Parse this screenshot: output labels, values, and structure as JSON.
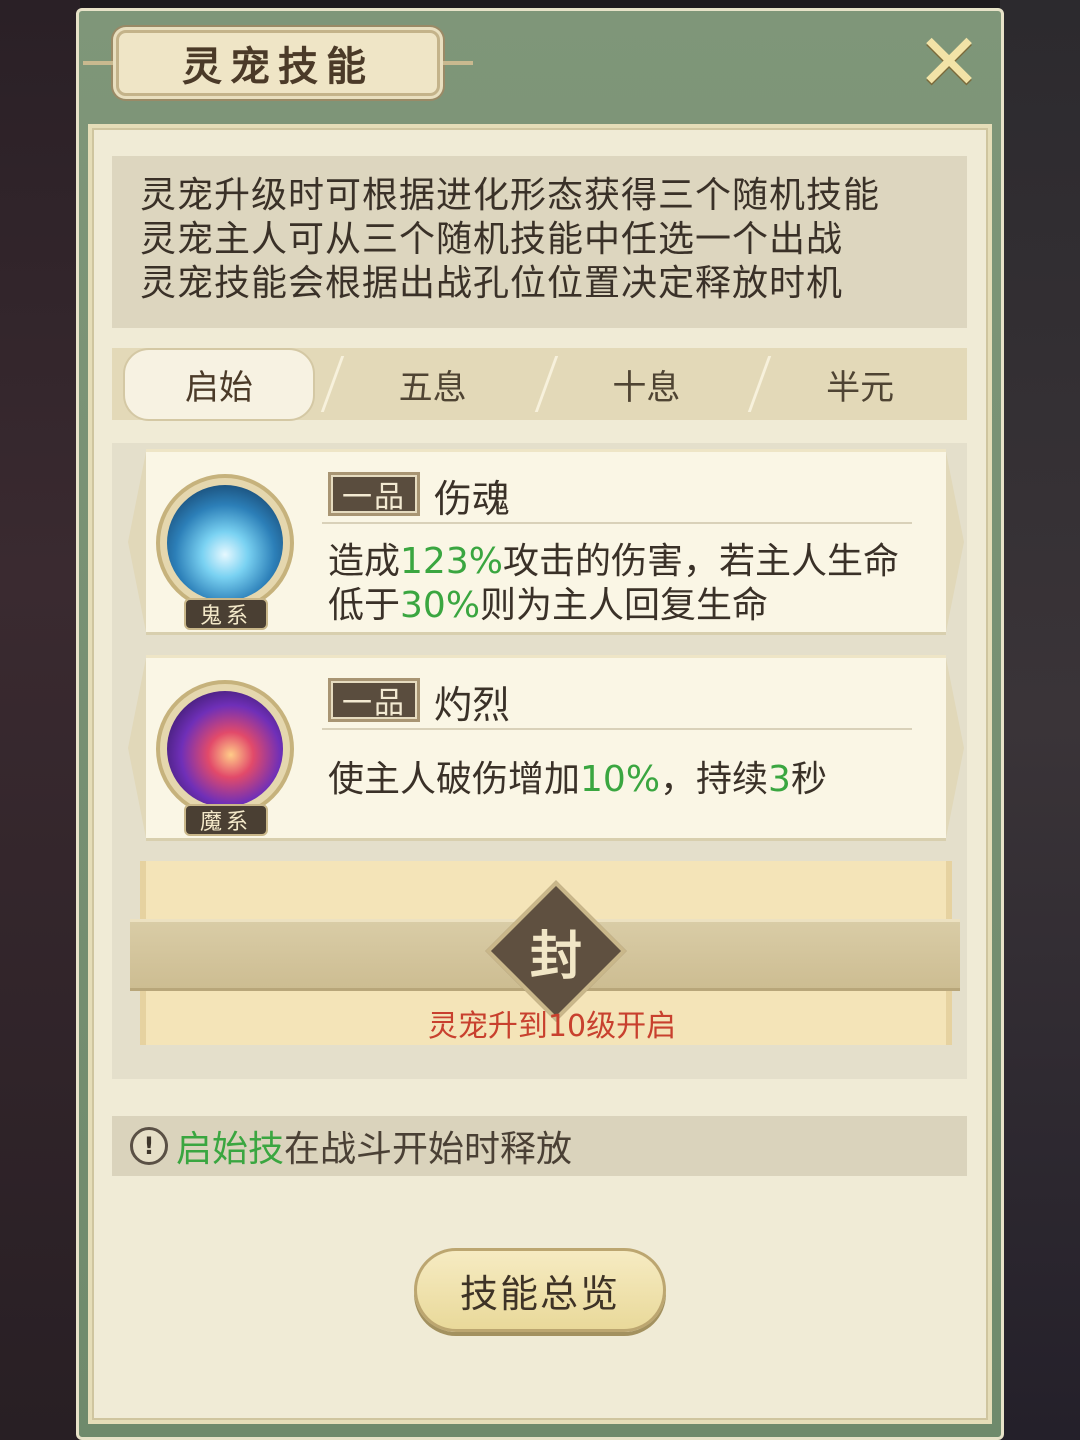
{
  "window": {
    "title": "灵宠技能",
    "close_glyph": "✕"
  },
  "description": {
    "lines": [
      "灵宠升级时可根据进化形态获得三个随机技能",
      "灵宠主人可从三个随机技能中任选一个出战",
      "灵宠技能会根据出战孔位位置决定释放时机"
    ]
  },
  "tabs": [
    {
      "label": "启始",
      "active": true
    },
    {
      "label": "五息",
      "active": false
    },
    {
      "label": "十息",
      "active": false
    },
    {
      "label": "半元",
      "active": false
    }
  ],
  "skills": [
    {
      "grade": "一品",
      "name": "伤魂",
      "element": "鬼系",
      "icon": "ghost-skill-icon",
      "desc_parts": [
        "造成",
        "123%",
        "攻击的伤害，若主人生命",
        "低于",
        "30%",
        "则为主人回复生命"
      ]
    },
    {
      "grade": "一品",
      "name": "灼烈",
      "element": "魔系",
      "icon": "demon-skill-icon",
      "desc_parts": [
        "使主人破伤增加",
        "10%",
        "，持续",
        "3",
        "秒"
      ]
    }
  ],
  "locked_slot": {
    "seal_char": "封",
    "unlock_text": "灵宠升到10级开启"
  },
  "tip": {
    "icon_glyph": "!",
    "highlight": "启始技",
    "rest": "在战斗开始时释放"
  },
  "buttons": {
    "overview_label": "技能总览"
  },
  "colors": {
    "frame_green": "#7f9679",
    "highlight_green": "#3aa640",
    "unlock_red": "#c8402e",
    "panel_cream": "#f0ebd6"
  }
}
